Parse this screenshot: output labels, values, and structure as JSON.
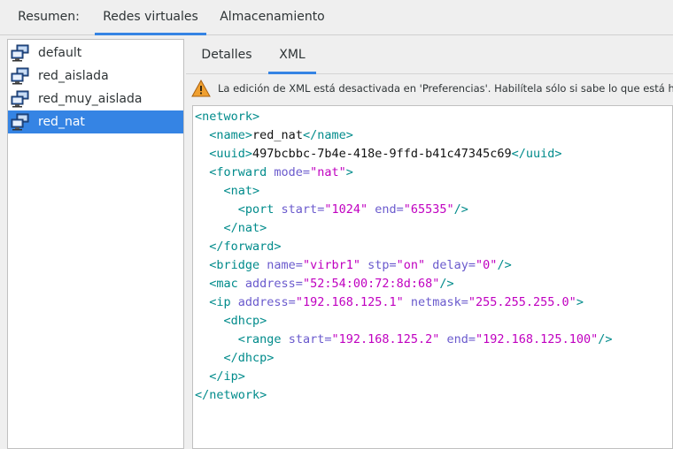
{
  "top_tabs": [
    {
      "label": "Resumen:"
    },
    {
      "label": "Redes virtuales"
    },
    {
      "label": "Almacenamiento"
    }
  ],
  "networks": [
    {
      "label": "default"
    },
    {
      "label": "red_aislada"
    },
    {
      "label": "red_muy_aislada"
    },
    {
      "label": "red_nat"
    }
  ],
  "selected_network": "red_nat",
  "sub_tabs": [
    {
      "label": "Detalles"
    },
    {
      "label": "XML"
    }
  ],
  "warning": {
    "icon": "warning-icon",
    "text": "La edición de XML está desactivada en 'Preferencias'. Habilítela sólo si sabe lo que está haciendo."
  },
  "xml": {
    "network_open": "<network>",
    "name_open": "<name>",
    "name_value": "red_nat",
    "name_close": "</name>",
    "uuid_open": "<uuid>",
    "uuid_value": "497bcbbc-7b4e-418e-9ffd-b41c47345c69",
    "uuid_close": "</uuid>",
    "forward_open": "<forward",
    "forward_mode_attr": " mode=",
    "forward_mode_val": "\"nat\"",
    "gt": ">",
    "nat_open": "<nat>",
    "port_open": "<port",
    "port_start_attr": " start=",
    "port_start_val": "\"1024\"",
    "port_end_attr": " end=",
    "port_end_val": "\"65535\"",
    "selfclose": "/>",
    "nat_close": "</nat>",
    "forward_close": "</forward>",
    "bridge_open": "<bridge",
    "bridge_name_attr": " name=",
    "bridge_name_val": "\"virbr1\"",
    "bridge_stp_attr": " stp=",
    "bridge_stp_val": "\"on\"",
    "bridge_delay_attr": " delay=",
    "bridge_delay_val": "\"0\"",
    "mac_open": "<mac",
    "mac_address_attr": " address=",
    "mac_address_val": "\"52:54:00:72:8d:68\"",
    "ip_open": "<ip",
    "ip_address_attr": " address=",
    "ip_address_val": "\"192.168.125.1\"",
    "ip_netmask_attr": " netmask=",
    "ip_netmask_val": "\"255.255.255.0\"",
    "dhcp_open": "<dhcp>",
    "range_open": "<range",
    "range_start_attr": " start=",
    "range_start_val": "\"192.168.125.2\"",
    "range_end_attr": " end=",
    "range_end_val": "\"192.168.125.100\"",
    "dhcp_close": "</dhcp>",
    "ip_close": "</ip>",
    "network_close": "</network>"
  },
  "colors": {
    "accent": "#3584e4",
    "xml_tag": "#008b8b",
    "xml_attr": "#6a5acd",
    "xml_value": "#c000c0"
  }
}
